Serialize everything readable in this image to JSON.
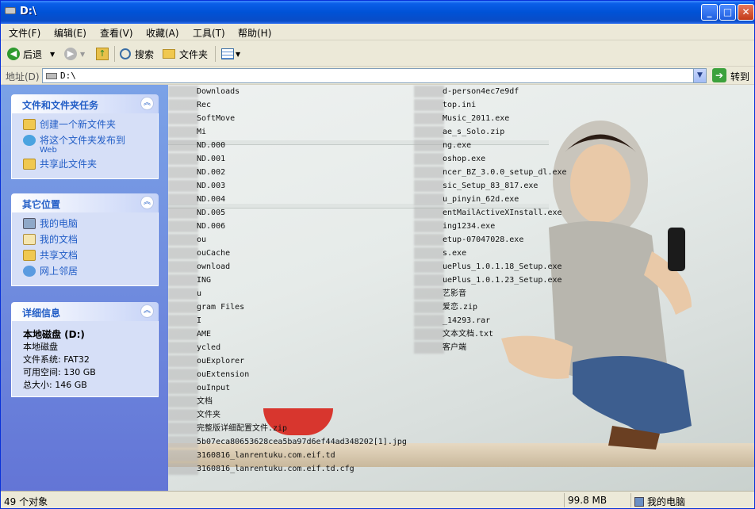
{
  "window": {
    "title": "D:\\"
  },
  "menu": [
    {
      "label": "文件(F)"
    },
    {
      "label": "编辑(E)"
    },
    {
      "label": "查看(V)"
    },
    {
      "label": "收藏(A)"
    },
    {
      "label": "工具(T)"
    },
    {
      "label": "帮助(H)"
    }
  ],
  "toolbar": {
    "back": "后退",
    "search": "搜索",
    "folders": "文件夹"
  },
  "address": {
    "label": "地址(D)",
    "value": "D:\\",
    "go": "转到"
  },
  "tasks": {
    "title": "文件和文件夹任务",
    "items": [
      {
        "label": "创建一个新文件夹",
        "sub": ""
      },
      {
        "label": "将这个文件夹发布到",
        "sub": "Web"
      },
      {
        "label": "共享此文件夹",
        "sub": ""
      }
    ]
  },
  "places": {
    "title": "其它位置",
    "items": [
      {
        "label": "我的电脑"
      },
      {
        "label": "我的文档"
      },
      {
        "label": "共享文档"
      },
      {
        "label": "网上邻居"
      }
    ]
  },
  "details": {
    "title": "详细信息",
    "name": "本地磁盘 (D:)",
    "type": "本地磁盘",
    "fs": "文件系统: FAT32",
    "free": "可用空间: 130 GB",
    "total": "总大小: 146 GB"
  },
  "files_left": [
    "Downloads",
    "Rec",
    "SoftMove",
    "Mi",
    "ND.000",
    "ND.001",
    "ND.002",
    "ND.003",
    "ND.004",
    "ND.005",
    "ND.006",
    "ou",
    "ouCache",
    "ownload",
    "ING",
    "u",
    "gram Files",
    "I",
    "AME",
    "ycled",
    "ouExplorer",
    "ouExtension",
    "ouInput",
    "文档",
    "文件夹",
    "完整版详细配置文件.zip",
    "5b07eca80653628cea5ba97d6ef44ad348202[1].jpg",
    "3160816_lanrentuku.com.eif.td",
    "3160816_lanrentuku.com.eif.td.cfg"
  ],
  "files_right": [
    "d-person4ec7e9df",
    "top.ini",
    "Music_2011.exe",
    "ae_s_Solo.zip",
    "ng.exe",
    "oshop.exe",
    "ncer_BZ_3.0.0_setup_dl.exe",
    "sic_Setup_83_817.exe",
    "u_pinyin_62d.exe",
    "entMailActiveXInstall.exe",
    "ing1234.exe",
    "etup-07047028.exe",
    "s.exe",
    "uePlus_1.0.1.18_Setup.exe",
    "uePlus_1.0.1.23_Setup.exe",
    "艺影音",
    "爱恋.zip",
    "_14293.rar",
    "文本文档.txt",
    "客户端"
  ],
  "status": {
    "count": "49 个对象",
    "size": "99.8 MB",
    "location": "我的电脑"
  },
  "colors": {
    "title_bar": "#0052d6",
    "sidebar": "#6375d6",
    "link": "#215dc6"
  }
}
